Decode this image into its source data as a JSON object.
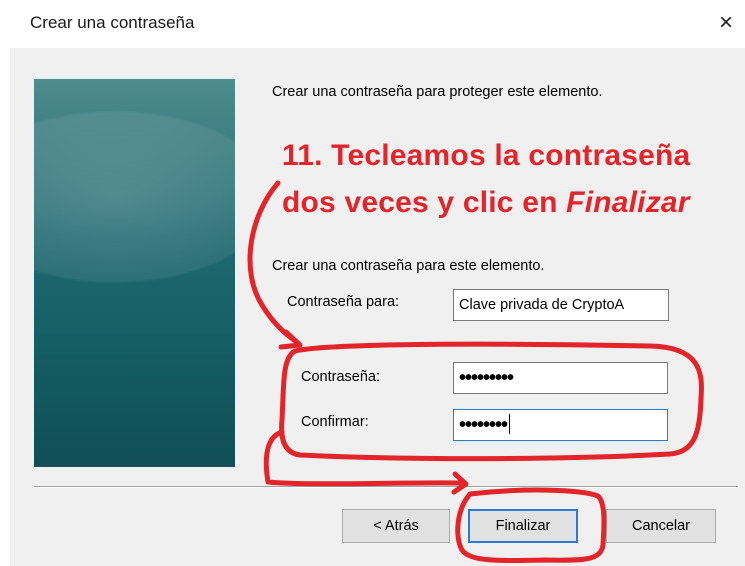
{
  "window": {
    "title": "Crear una contraseña",
    "close_glyph": "×"
  },
  "intro_text": "Crear una contraseña para proteger este elemento.",
  "annotation": {
    "line1": "11. Tecleamos la contraseña",
    "line2_prefix": "dos veces y clic en ",
    "line2_emphasis": "Finalizar",
    "color": "#e3242b"
  },
  "section_label": "Crear una contraseña para este elemento.",
  "fields": {
    "password_for": {
      "label": "Contraseña para:",
      "value": "Clave privada de CryptoA"
    },
    "password": {
      "label": "Contraseña:",
      "value": "•••••••••"
    },
    "confirm": {
      "label": "Confirmar:",
      "value": "••••••••"
    }
  },
  "buttons": {
    "back": "< Atrás",
    "finish": "Finalizar",
    "cancel": "Cancelar"
  },
  "icons": {
    "close": "close-icon",
    "side_banner": "wizard-banner-image"
  }
}
